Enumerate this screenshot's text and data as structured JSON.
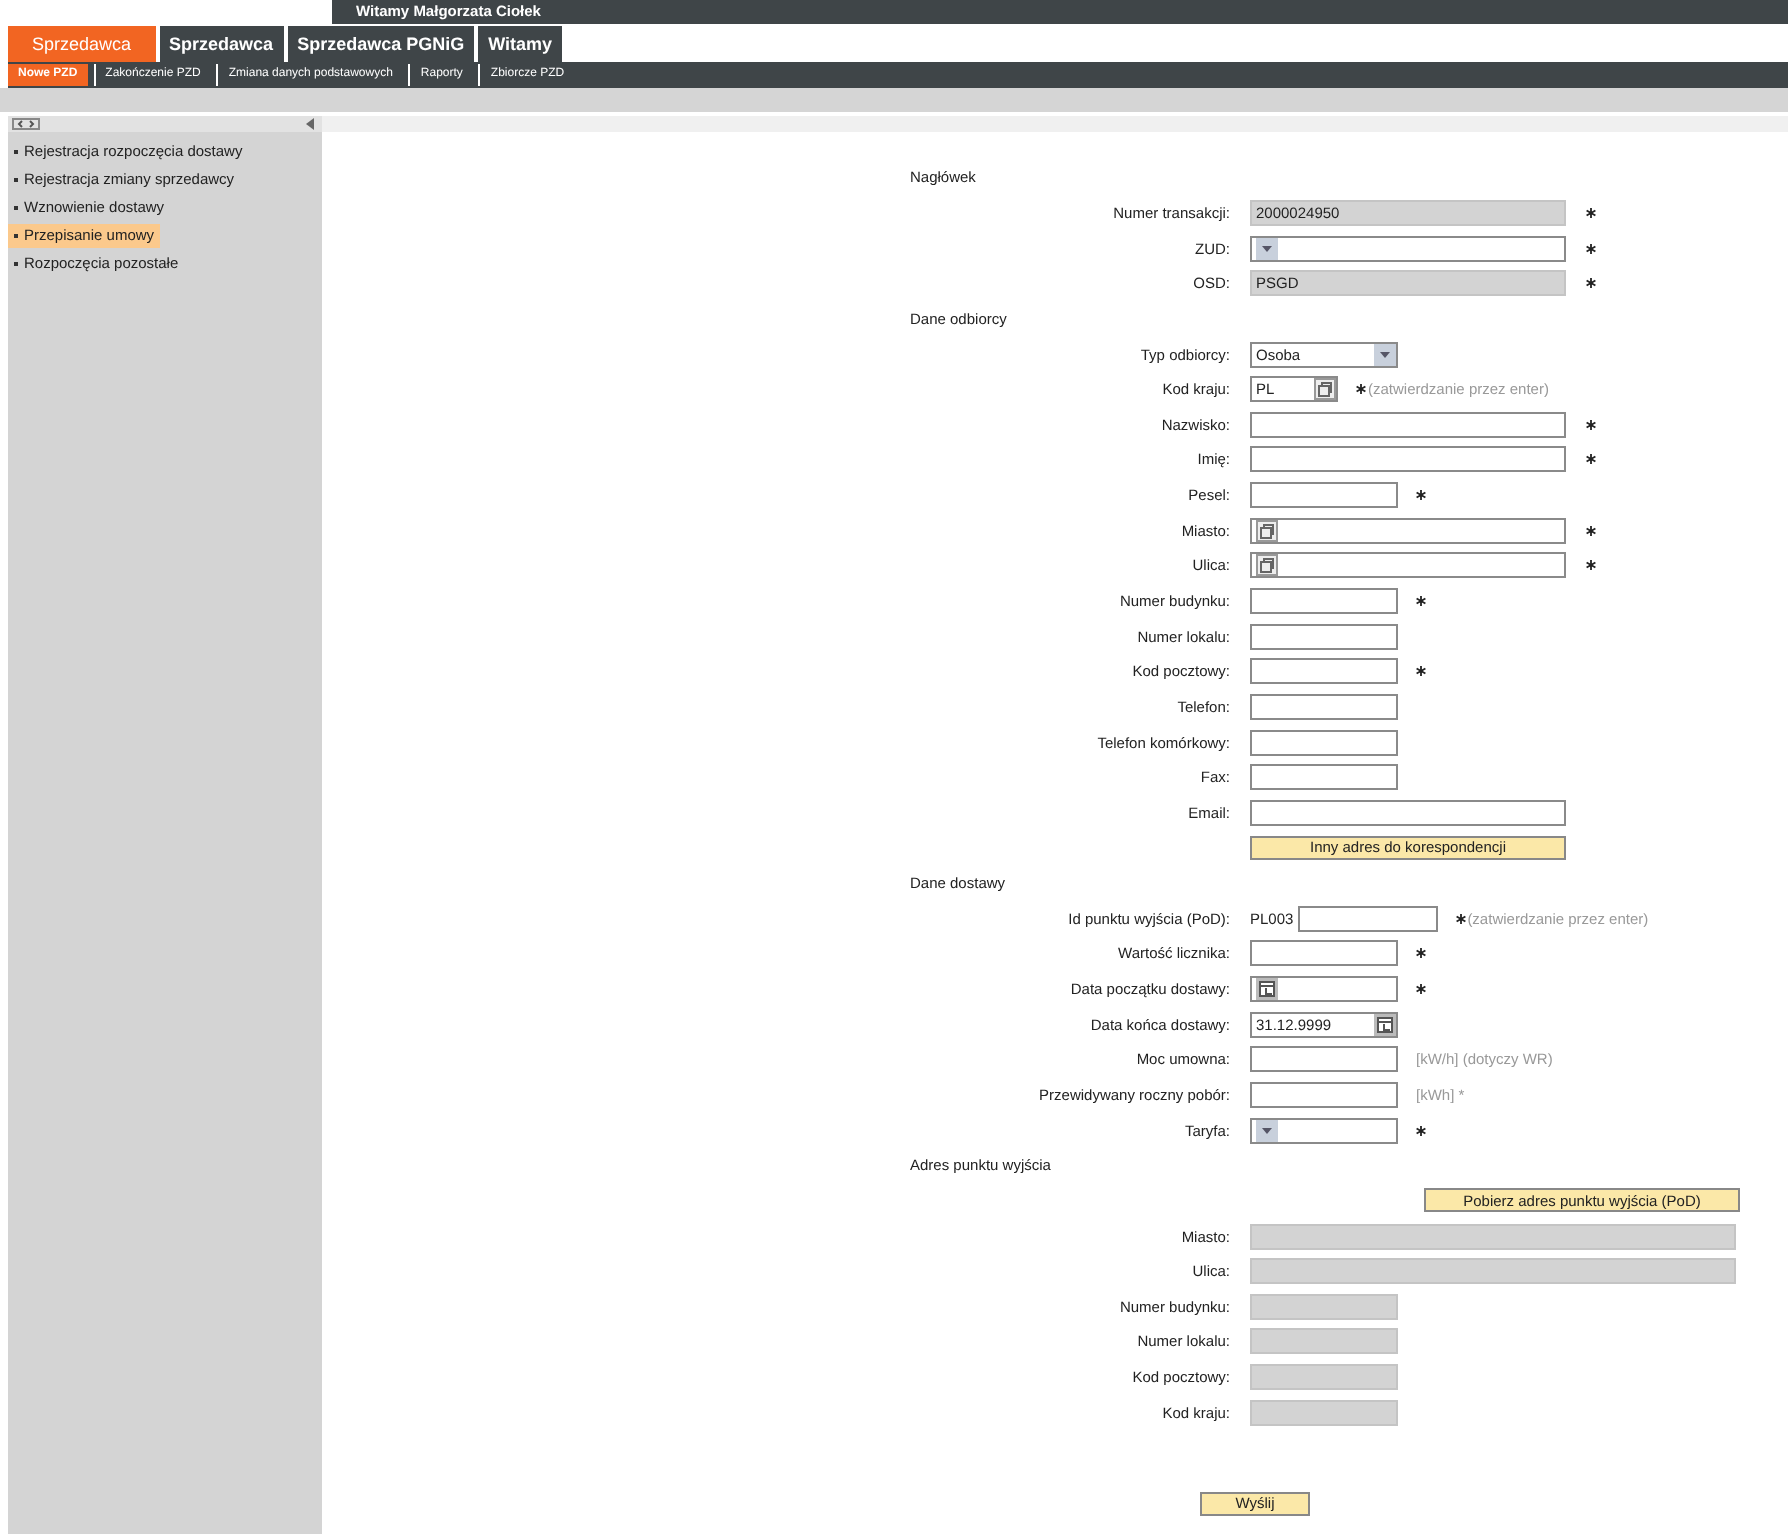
{
  "header": {
    "greeting": "Witamy Małgorzata Ciołek"
  },
  "tabs": [
    {
      "label": "Sprzedawca",
      "selected": true
    },
    {
      "label": "Sprzedawca",
      "selected": false
    },
    {
      "label": "Sprzedawca PGNiG",
      "selected": false
    },
    {
      "label": "Witamy",
      "selected": false
    }
  ],
  "subnav": [
    {
      "label": "Nowe PZD",
      "selected": true
    },
    {
      "label": "Zakończenie PZD",
      "selected": false
    },
    {
      "label": "Zmiana danych podstawowych",
      "selected": false
    },
    {
      "label": "Raporty",
      "selected": false
    },
    {
      "label": "Zbiorcze PZD",
      "selected": false
    }
  ],
  "sidebar": {
    "items": [
      {
        "label": "Rejestracja rozpoczęcia dostawy",
        "selected": false
      },
      {
        "label": "Rejestracja zmiany sprzedawcy",
        "selected": false
      },
      {
        "label": "Wznowienie dostawy",
        "selected": false
      },
      {
        "label": "Przepisanie umowy",
        "selected": true
      },
      {
        "label": "Rozpoczęcia pozostałe",
        "selected": false
      }
    ]
  },
  "sections": [
    {
      "title": "Nagłówek",
      "rows": [
        {
          "kind": "readonly",
          "label": "Numer transakcji:",
          "value": "2000024950",
          "wide": true,
          "required": true
        },
        {
          "kind": "select",
          "label": "ZUD:",
          "wide": true,
          "required": true
        },
        {
          "kind": "readonly",
          "label": "OSD:",
          "value": "PSGD",
          "wide": true,
          "required": true
        }
      ]
    },
    {
      "title": "Dane odbiorcy",
      "rows": [
        {
          "kind": "select",
          "label": "Typ odbiorcy:",
          "value": "Osoba",
          "wide": false,
          "required": false
        },
        {
          "kind": "lookup",
          "label": "Kod kraju:",
          "value": "PL",
          "wide": false,
          "required": true,
          "hint": "(zatwierdzanie przez enter)"
        },
        {
          "kind": "text",
          "label": "Nazwisko:",
          "wide": true,
          "required": true
        },
        {
          "kind": "text",
          "label": "Imię:",
          "wide": true,
          "required": true
        },
        {
          "kind": "text",
          "label": "Pesel:",
          "wide": false,
          "required": true
        },
        {
          "kind": "lookup",
          "label": "Miasto:",
          "wide": true,
          "required": true
        },
        {
          "kind": "lookup",
          "label": "Ulica:",
          "wide": true,
          "required": true
        },
        {
          "kind": "text",
          "label": "Numer budynku:",
          "wide": false,
          "required": true
        },
        {
          "kind": "text",
          "label": "Numer lokalu:",
          "wide": false,
          "required": false
        },
        {
          "kind": "text",
          "label": "Kod pocztowy:",
          "wide": false,
          "required": true
        },
        {
          "kind": "text",
          "label": "Telefon:",
          "wide": false,
          "required": false
        },
        {
          "kind": "text",
          "label": "Telefon komórkowy:",
          "wide": false,
          "required": false
        },
        {
          "kind": "text",
          "label": "Fax:",
          "wide": false,
          "required": false
        },
        {
          "kind": "text",
          "label": "Email:",
          "wide": true,
          "required": false
        },
        {
          "kind": "button",
          "label": "Inny adres do korespondencji"
        }
      ]
    },
    {
      "title": "Dane dostawy",
      "rows": [
        {
          "kind": "prefixed",
          "label": "Id punktu wyjścia (PoD):",
          "prefix": "PL003",
          "required": true,
          "hint": "(zatwierdzanie przez enter)"
        },
        {
          "kind": "text",
          "label": "Wartość licznika:",
          "wide": false,
          "required": true
        },
        {
          "kind": "date",
          "label": "Data początku dostawy:",
          "required": true
        },
        {
          "kind": "date",
          "label": "Data końca dostawy:",
          "value": "31.12.9999",
          "required": false
        },
        {
          "kind": "text",
          "label": "Moc umowna:",
          "wide": false,
          "required": false,
          "hint": "[kW/h] (dotyczy WR)"
        },
        {
          "kind": "text",
          "label": "Przewidywany roczny pobór:",
          "wide": false,
          "required": false,
          "hint": "[kWh] *"
        },
        {
          "kind": "select",
          "label": "Taryfa:",
          "wide": false,
          "required": true
        }
      ]
    },
    {
      "title": "Adres punktu wyjścia",
      "rows": [
        {
          "kind": "button",
          "label": "Pobierz adres punktu wyjścia (PoD)"
        },
        {
          "kind": "readonly",
          "label": "Miasto:",
          "wide": true,
          "full": true,
          "required": false
        },
        {
          "kind": "readonly",
          "label": "Ulica:",
          "wide": true,
          "full": true,
          "required": false
        },
        {
          "kind": "readonly",
          "label": "Numer budynku:",
          "wide": false,
          "required": false
        },
        {
          "kind": "readonly",
          "label": "Numer lokalu:",
          "wide": false,
          "required": false
        },
        {
          "kind": "readonly",
          "label": "Kod pocztowy:",
          "wide": false,
          "required": false
        },
        {
          "kind": "readonly",
          "label": "Kod kraju:",
          "wide": false,
          "required": false
        }
      ]
    }
  ],
  "submit": {
    "label": "Wyślij"
  }
}
